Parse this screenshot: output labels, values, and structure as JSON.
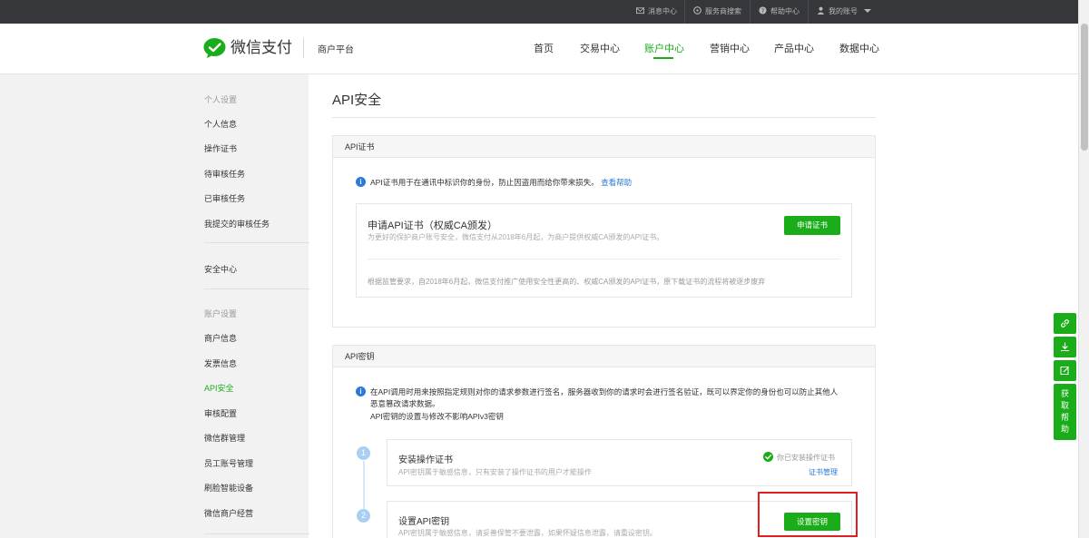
{
  "topbar": {
    "messages": "消息中心",
    "service_search": "服务商搜索",
    "help": "帮助中心",
    "account": "我的账号"
  },
  "header": {
    "brand": "微信支付",
    "platform": "商户平台",
    "nav": [
      "首页",
      "交易中心",
      "账户中心",
      "营销中心",
      "产品中心",
      "数据中心"
    ],
    "active_nav": "账户中心",
    "accent_color": "#1aad19"
  },
  "sidebar": {
    "group_personal": "个人设置",
    "personal_items": [
      "个人信息",
      "操作证书",
      "待审核任务",
      "已审核任务",
      "我提交的审核任务"
    ],
    "security_center": "安全中心",
    "group_account": "账户设置",
    "account_items": [
      "商户信息",
      "发票信息",
      "API安全",
      "审核配置",
      "微信群管理",
      "员工账号管理",
      "刷脸智能设备",
      "微信商户经营"
    ],
    "active_item": "API安全"
  },
  "main": {
    "title": "API安全",
    "cert_panel": {
      "header": "API证书",
      "info": "API证书用于在通讯中标识你的身份，防止因盗用而给你带来损失。",
      "help_link": "查看帮助",
      "card_title": "申请API证书（权威CA颁发）",
      "card_desc": "为更好的保护商户账号安全，微信支付从2018年6月起，为商户提供权威CA颁发的API证书。",
      "apply_button": "申请证书",
      "notice": "根据监管要求，自2018年6月起，微信支付推广使用安全性更高的、权威CA颁发的API证书，原下载证书的流程将被逐步废弃"
    },
    "key_panel": {
      "header": "API密钥",
      "info_line1": "在API调用时用来按照指定规则对你的请求参数进行签名，服务器收到你的请求时会进行签名验证，既可以界定你的身份也可以防止其他人",
      "info_line2": "恶意篡改请求数据。",
      "info_line3": "API密钥的设置与修改不影响APIv3密钥",
      "steps": [
        {
          "num": "1",
          "title": "安装操作证书",
          "desc": "API密钥属于敏感信息，只有安装了操作证书的用户才能操作",
          "status": "你已安装操作证书",
          "link": "证书管理"
        },
        {
          "num": "2",
          "title": "设置API密钥",
          "desc": "API密钥属于敏感信息，请妥善保管不要泄露，如果怀疑信息泄露，请重设密钥。",
          "button": "设置密钥"
        }
      ]
    }
  },
  "float_tools": {
    "icons": [
      "link-icon",
      "download-icon",
      "edit-icon"
    ],
    "help_chars": [
      "获",
      "取",
      "帮",
      "助"
    ]
  }
}
